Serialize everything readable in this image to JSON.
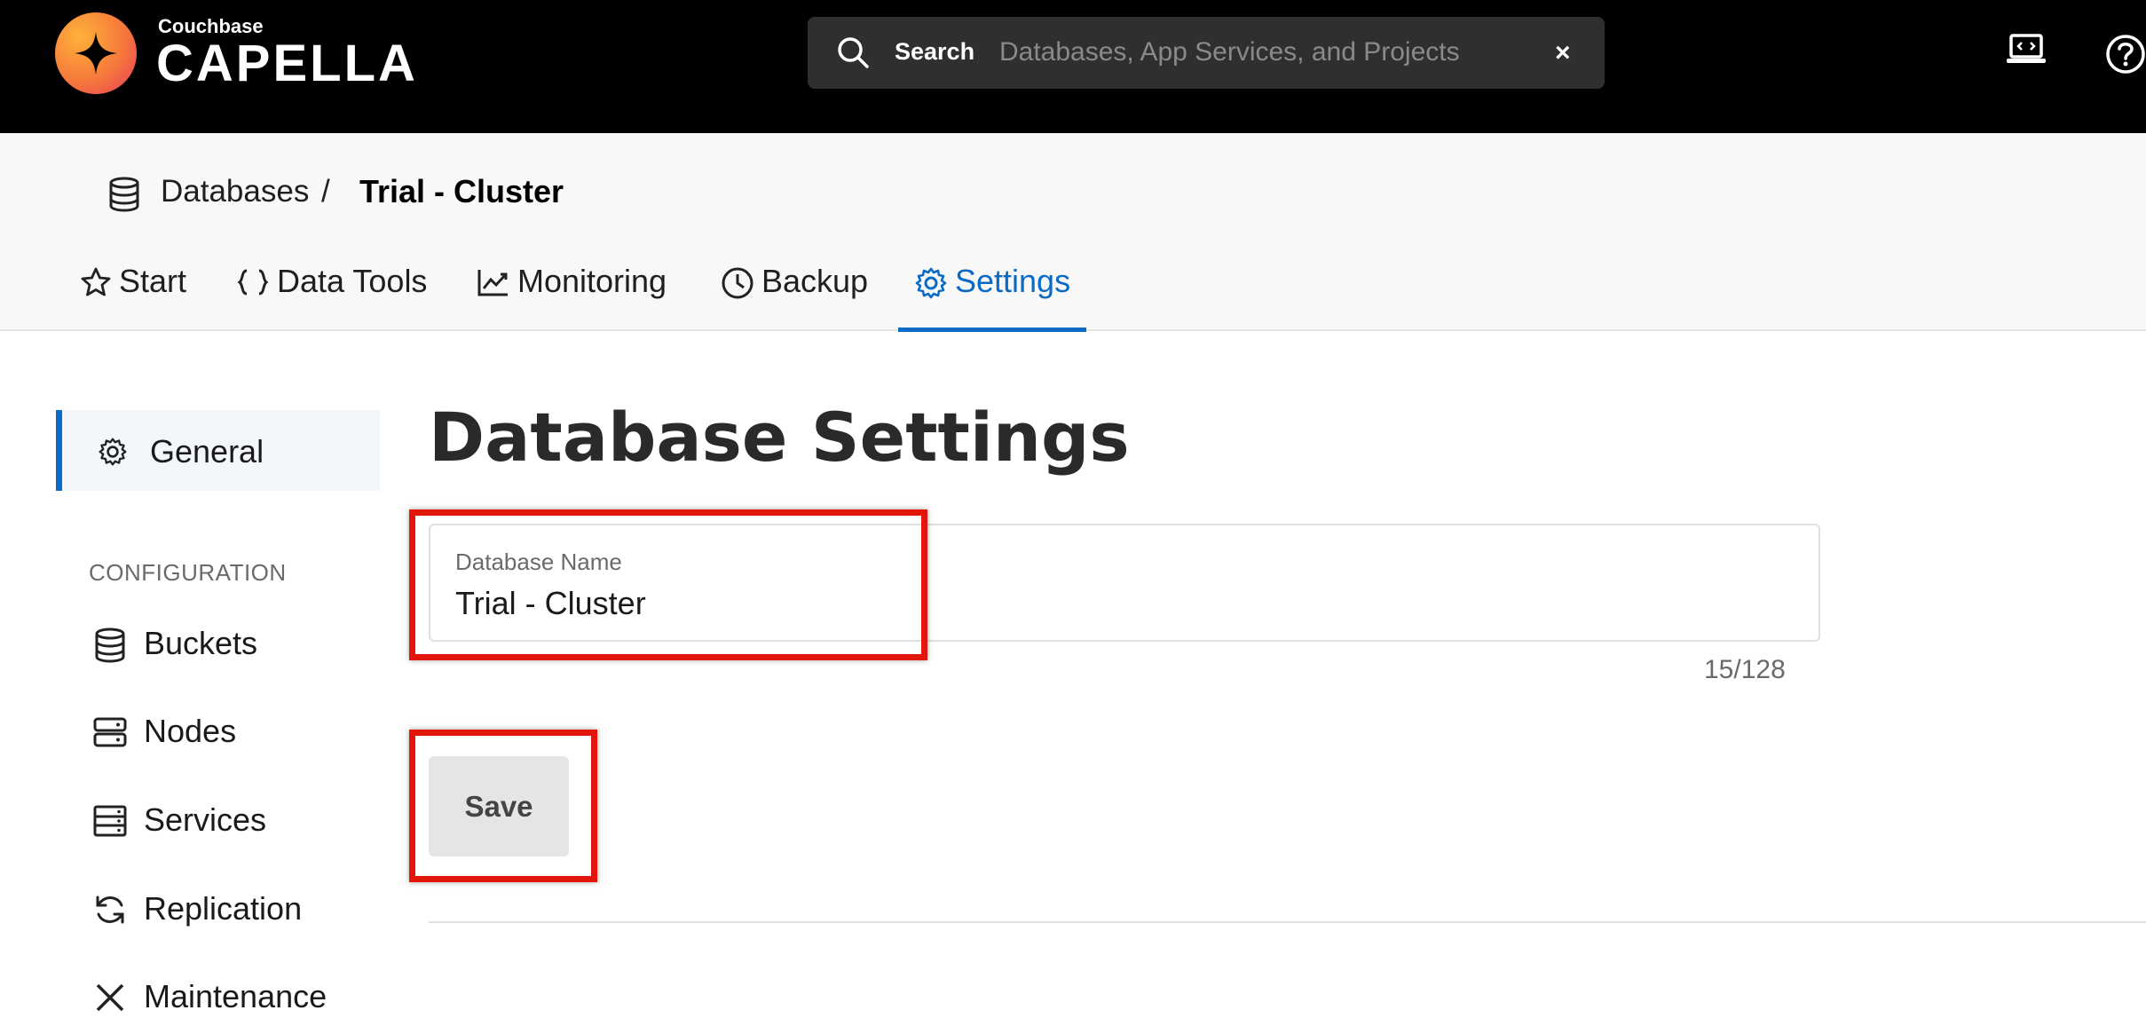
{
  "header": {
    "brand_small": "Couchbase",
    "brand_big": "CAPELLA",
    "search_label": "Search",
    "search_placeholder": "Databases, App Services, and Projects",
    "search_clear": "×"
  },
  "breadcrumb": {
    "root": "Databases",
    "separator": "/",
    "current": "Trial - Cluster"
  },
  "tabs": [
    {
      "label": "Start",
      "icon": "star-icon"
    },
    {
      "label": "Data Tools",
      "icon": "braces-icon"
    },
    {
      "label": "Monitoring",
      "icon": "chart-line-icon"
    },
    {
      "label": "Backup",
      "icon": "clock-icon"
    },
    {
      "label": "Settings",
      "icon": "gear-icon",
      "active": true
    }
  ],
  "sidebar": {
    "general": "General",
    "config_heading": "CONFIGURATION",
    "items": [
      {
        "label": "Buckets",
        "icon": "database-icon"
      },
      {
        "label": "Nodes",
        "icon": "server-icon"
      },
      {
        "label": "Services",
        "icon": "services-icon"
      },
      {
        "label": "Replication",
        "icon": "sync-icon"
      },
      {
        "label": "Maintenance",
        "icon": "tools-icon"
      }
    ]
  },
  "main": {
    "title": "Database Settings",
    "field_label": "Database Name",
    "field_value": "Trial - Cluster",
    "counter": "15/128",
    "save_label": "Save"
  },
  "colors": {
    "accent": "#0a6bc6",
    "topbar": "#000000",
    "highlight": "#e3160b"
  }
}
